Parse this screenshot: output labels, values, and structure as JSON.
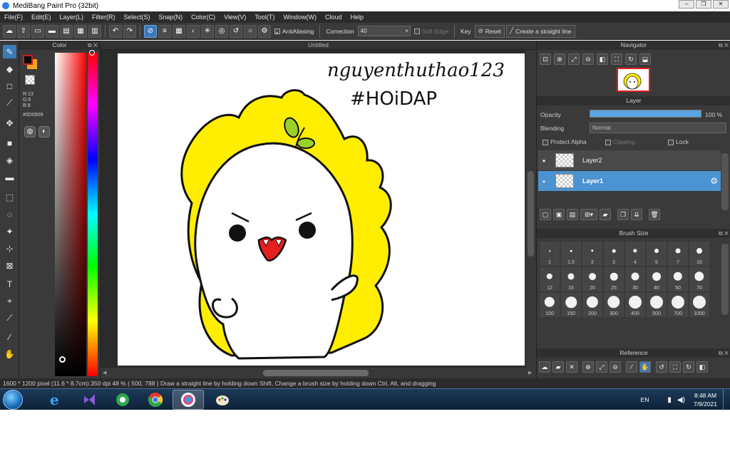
{
  "window": {
    "title": "MediBang Paint Pro (32bit)",
    "controls": [
      "–",
      "❐",
      "✕"
    ]
  },
  "menu": [
    "File(F)",
    "Edit(E)",
    "Layer(L)",
    "Filter(R)",
    "Select(S)",
    "Snap(N)",
    "Color(C)",
    "View(V)",
    "Tool(T)",
    "Window(W)",
    "Cloud",
    "Help"
  ],
  "toolbar": {
    "antialiasing_label": "AntiAliasing",
    "correction_label": "Correction",
    "correction_value": "40",
    "soft_edge_label": "Soft Edge",
    "key_label": "Key",
    "reset_label": "Reset",
    "create_line_label": "Create a straight line"
  },
  "color_panel": {
    "title": "Color",
    "r": "R:13",
    "g": "G:9",
    "b": "B:9",
    "hex": "#0D0909",
    "fg_color": "#0D0909",
    "bg_color": "#F3A41C"
  },
  "canvas": {
    "tab_title": "Untitled",
    "handwriting_line1": "nguyenthuthao123",
    "handwriting_line2": "#HOiDAP"
  },
  "navigator": {
    "title": "Navigator"
  },
  "layer_panel": {
    "title": "Layer",
    "opacity_label": "Opacity",
    "opacity_value": "100 %",
    "opacity_fraction": 1.0,
    "blending_label": "Blending",
    "blending_value": "Normal",
    "protect_alpha_label": "Protect Alpha",
    "clipping_label": "Clipping",
    "lock_label": "Lock",
    "layers": [
      {
        "name": "Layer2",
        "selected": false
      },
      {
        "name": "Layer1",
        "selected": true
      }
    ]
  },
  "brush_size": {
    "title": "Brush Size",
    "sizes": [
      "1",
      "1.5",
      "2",
      "3",
      "4",
      "5",
      "7",
      "10",
      "12",
      "15",
      "20",
      "25",
      "30",
      "40",
      "50",
      "70",
      "100",
      "150",
      "200",
      "300",
      "400",
      "500",
      "700",
      "1000"
    ]
  },
  "reference": {
    "title": "Reference"
  },
  "status": {
    "text": "1600 * 1200 pixel   (11.6 * 8.7cm)   350 dpi   48 %   ( 500, 788 )   Draw a straight line by holding down Shift, Change a brush size by holding down Ctrl, Alt, and dragging"
  },
  "taskbar": {
    "language": "EN",
    "time": "8:48 AM",
    "date": "7/9/2021"
  }
}
